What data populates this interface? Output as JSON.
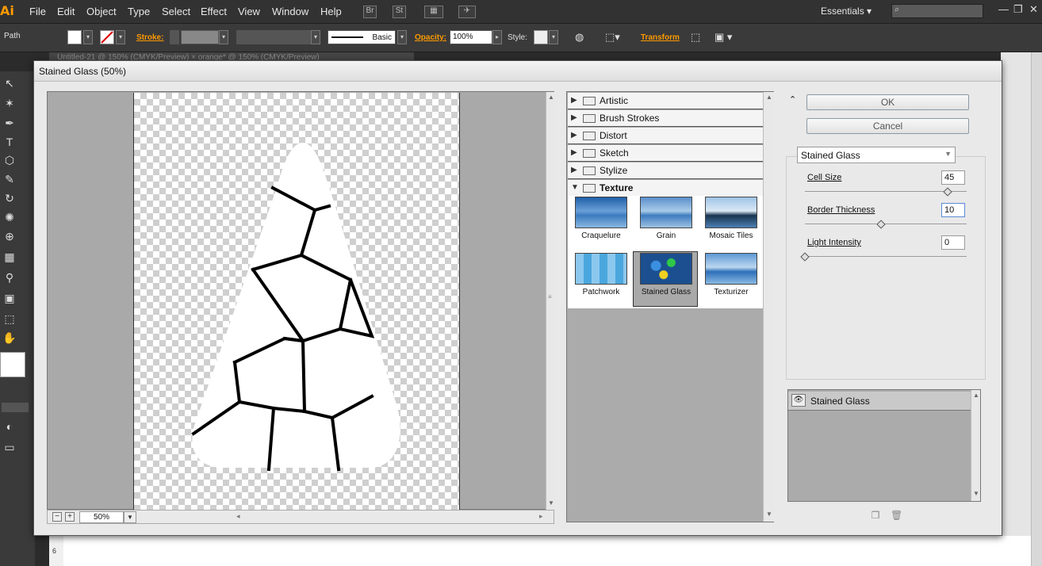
{
  "app": {
    "logo": "Ai",
    "menu": [
      "File",
      "Edit",
      "Object",
      "Type",
      "Select",
      "Effect",
      "View",
      "Window",
      "Help"
    ],
    "bridge_btn": "Br",
    "stock_btn": "St",
    "workspace": "Essentials",
    "workspace_arrow": "▾",
    "window_controls": [
      "—",
      "❐",
      "✕"
    ]
  },
  "controlbar": {
    "selection_type": "Path",
    "stroke_label": "Stroke:",
    "brush_label": "Basic",
    "opacity_label": "Opacity:",
    "opacity_value": "100%",
    "style_label": "Style:",
    "transform_label": "Transform"
  },
  "doc_tabs": "Untitled-21 @ 150% (CMYK/Preview)   ×    orange* @ 150% (CMYK/Preview)",
  "ruler_number": "6",
  "dialog": {
    "title": "Stained Glass (50%)",
    "zoom_value": "50%",
    "zoom_minus": "−",
    "zoom_plus": "+",
    "categories": [
      {
        "name": "Artistic",
        "expanded": false
      },
      {
        "name": "Brush Strokes",
        "expanded": false
      },
      {
        "name": "Distort",
        "expanded": false
      },
      {
        "name": "Sketch",
        "expanded": false
      },
      {
        "name": "Stylize",
        "expanded": false
      },
      {
        "name": "Texture",
        "expanded": true
      }
    ],
    "thumbnails": [
      {
        "caption": "Craquelure",
        "selected": false
      },
      {
        "caption": "Grain",
        "selected": false
      },
      {
        "caption": "Mosaic Tiles",
        "selected": false
      },
      {
        "caption": "Patchwork",
        "selected": false
      },
      {
        "caption": "Stained Glass",
        "selected": true
      },
      {
        "caption": "Texturizer",
        "selected": false
      }
    ],
    "collapse_icon": "⌃",
    "ok_label": "OK",
    "cancel_label": "Cancel",
    "filter_select": "Stained Glass",
    "params": [
      {
        "label": "Cell Size",
        "value": "45",
        "fraction": 0.9
      },
      {
        "label": "Border Thickness",
        "value": "10",
        "fraction": 0.48
      },
      {
        "label": "Light Intensity",
        "value": "0",
        "fraction": 0.0
      }
    ],
    "effect_layer": "Stained Glass"
  },
  "colors": {
    "accent_orange": "#ff9a00",
    "selected_thumb": "#a9a9a9",
    "canvas_bg": "#a9a9a9"
  }
}
